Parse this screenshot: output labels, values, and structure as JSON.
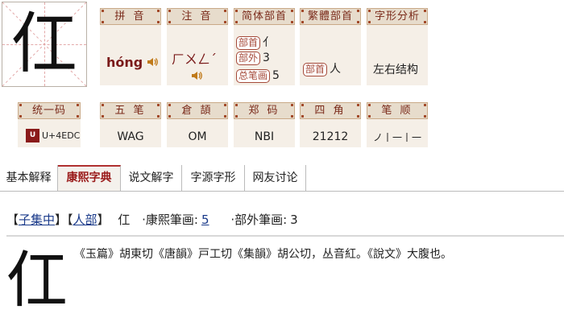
{
  "character": "仜",
  "pinyin": {
    "header": "拼 音",
    "value": "hóng"
  },
  "zhuyin": {
    "header": "注 音",
    "value": "ㄏㄨㄥˊ"
  },
  "simplified_radical": {
    "header": "简体部首",
    "radical_tag": "部首",
    "radical_value": "亻",
    "outside_tag": "部外",
    "outside_value": "3",
    "total_tag": "总笔画",
    "total_value": "5"
  },
  "traditional_radical": {
    "header": "繁體部首",
    "radical_tag": "部首",
    "radical_value": "人"
  },
  "structure": {
    "header": "字形分析",
    "value": "左右结构"
  },
  "unicode": {
    "header": "统一码",
    "value": "U+4EDC",
    "logo": "unicode"
  },
  "wubi": {
    "header": "五 笔",
    "value": "WAG"
  },
  "cangjie": {
    "header": "倉 頡",
    "value": "OM"
  },
  "zhengma": {
    "header": "郑 码",
    "value": "NBI"
  },
  "sijiao": {
    "header": "四 角",
    "value": "21212"
  },
  "stroke_order": {
    "header": "笔 顺",
    "value": "ノ丨一丨一"
  },
  "tabs": [
    {
      "label": "基本解释"
    },
    {
      "label": "康熙字典"
    },
    {
      "label": "说文解字"
    },
    {
      "label": "字源字形"
    },
    {
      "label": "网友讨论"
    }
  ],
  "kangxi": {
    "bracket_open": "【",
    "collection": "子集中",
    "bracket_mid": "】【",
    "radical_link": "人部",
    "bracket_close": "】",
    "char": "仜",
    "strokes_label": "·康熙筆画:",
    "strokes_value": "5",
    "outside_label": "·部外筆画:",
    "outside_value": "3",
    "definition": "《玉篇》胡東切《唐韻》戸工切《集韻》胡公切，丛音紅。《說文》大腹也。"
  },
  "colors": {
    "accent": "#9a1a1a",
    "header_bg": "#e7dccc",
    "cell_bg": "#f5efe7",
    "link": "#1a3a8a"
  }
}
